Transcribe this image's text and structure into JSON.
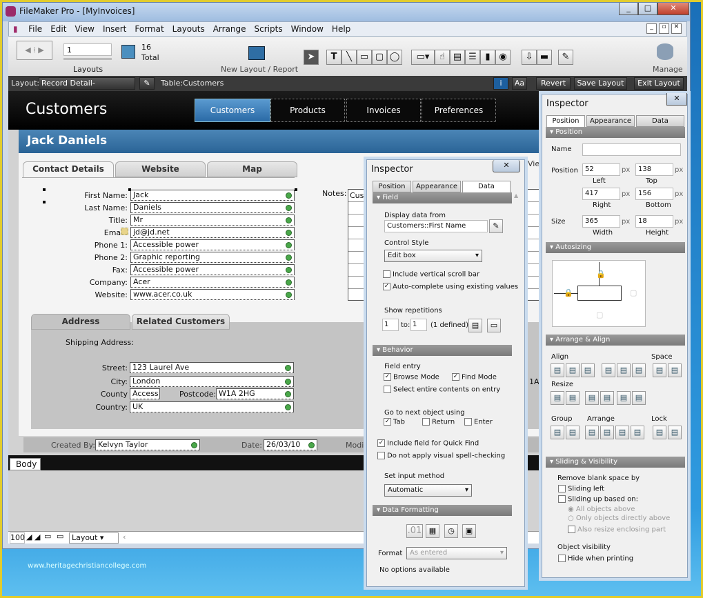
{
  "window": {
    "title": "FileMaker Pro - [MyInvoices]",
    "controls": [
      "_",
      "□",
      "✕"
    ],
    "doc_controls": [
      "_",
      "▫",
      "✕"
    ]
  },
  "menu": [
    "File",
    "Edit",
    "View",
    "Insert",
    "Format",
    "Layouts",
    "Arrange",
    "Scripts",
    "Window",
    "Help"
  ],
  "toolbar": {
    "layout_number": "1",
    "layouts_label": "Layouts",
    "total_count": "16",
    "total_label": "Total",
    "new_layout_label": "New Layout / Report",
    "manage_label": "Manage"
  },
  "layoutbar": {
    "layout_label": "Layout:",
    "layout_value": "Record Detail-Customers",
    "table_label": "Table:",
    "table_value": "Customers",
    "revert": "Revert",
    "save": "Save Layout",
    "exit": "Exit Layout"
  },
  "header": {
    "title": "Customers",
    "nav": [
      "Customers",
      "Products",
      "Invoices",
      "Preferences"
    ],
    "record_name": "Jack Daniels"
  },
  "tabs": [
    "Contact Details",
    "Website",
    "Map"
  ],
  "fields": [
    {
      "label": "First Name:",
      "value": "Jack"
    },
    {
      "label": "Last Name:",
      "value": "Daniels"
    },
    {
      "label": "Title:",
      "value": "Mr"
    },
    {
      "label": "Email:",
      "value": "jd@jd.net"
    },
    {
      "label": "Phone 1:",
      "value": "Accessible power"
    },
    {
      "label": "Phone 2:",
      "value": "Graphic reporting"
    },
    {
      "label": "Fax:",
      "value": "Accessible power"
    },
    {
      "label": "Company:",
      "value": "Acer"
    },
    {
      "label": "Website:",
      "value": "www.acer.co.uk"
    }
  ],
  "notes": {
    "label": "Notes:",
    "value": "Cust"
  },
  "address": {
    "tabs": [
      "Address",
      "Related Customers"
    ],
    "shipping_label": "Shipping Address:",
    "street": {
      "label": "Street:",
      "value": "123 Laurel Ave"
    },
    "city": {
      "label": "City:",
      "value": "London"
    },
    "county": {
      "label": "County",
      "value": "Access"
    },
    "postcode": {
      "label": "Postcode:",
      "value": "W1A 2HG"
    },
    "country": {
      "label": "Country:",
      "value": "UK"
    },
    "right_fragment": "1A"
  },
  "footer": {
    "created_label": "Created By:",
    "created_value": "Kelvyn Taylor",
    "date_label": "Date:",
    "date_value": "26/03/10",
    "modified_label": "Modifi"
  },
  "part_label": "Body",
  "statusbar": {
    "zoom": "100",
    "mode": "Layout"
  },
  "watermark": "www.heritagechristiancollege.com",
  "inspector_data": {
    "title": "Inspector",
    "tabs": [
      "Position",
      "Appearance",
      "Data"
    ],
    "active_tab": "Data",
    "behind_text": "View",
    "field_section": "Field",
    "display_from_label": "Display data from",
    "display_from_value": "Customers::First Name",
    "control_style_label": "Control Style",
    "control_style_value": "Edit box",
    "vscroll": {
      "label": "Include vertical scroll bar",
      "checked": false
    },
    "autocomplete": {
      "label": "Auto-complete using existing values",
      "checked": true
    },
    "show_rep_label": "Show repetitions",
    "rep_from": "1",
    "rep_to_label": "to:",
    "rep_to": "1",
    "rep_defined": "(1 defined)",
    "behavior_section": "Behavior",
    "field_entry_label": "Field entry",
    "browse_mode": {
      "label": "Browse Mode",
      "checked": true
    },
    "find_mode": {
      "label": "Find Mode",
      "checked": true
    },
    "select_entire": {
      "label": "Select entire contents on entry",
      "checked": false
    },
    "next_object_label": "Go to next object using",
    "tab": {
      "label": "Tab",
      "checked": true
    },
    "return": {
      "label": "Return",
      "checked": false
    },
    "enter": {
      "label": "Enter",
      "checked": false
    },
    "quick_find": {
      "label": "Include field for Quick Find",
      "checked": true
    },
    "spell": {
      "label": "Do not apply visual spell-checking",
      "checked": false
    },
    "input_method_label": "Set input method",
    "input_method_value": "Automatic",
    "formatting_section": "Data Formatting",
    "format_icons": [
      ".01",
      "calendar",
      "clock",
      "image"
    ],
    "format_label": "Format",
    "format_value": "As entered",
    "no_options": "No options available"
  },
  "inspector_position": {
    "title": "Inspector",
    "tabs": [
      "Position",
      "Appearance",
      "Data"
    ],
    "active_tab": "Position",
    "position_section": "Position",
    "name_label": "Name",
    "name_value": "",
    "position_label": "Position",
    "left": "52",
    "top": "138",
    "right": "417",
    "bottom": "156",
    "left_label": "Left",
    "top_label": "Top",
    "right_label": "Right",
    "bottom_label": "Bottom",
    "size_label": "Size",
    "width": "365",
    "height": "18",
    "width_label": "Width",
    "height_label": "Height",
    "unit": "px",
    "autosizing_section": "Autosizing",
    "arrange_section": "Arrange & Align",
    "align_label": "Align",
    "space_label": "Space",
    "resize_label": "Resize",
    "group_label": "Group",
    "arrange_label": "Arrange",
    "lock_label": "Lock",
    "sliding_section": "Sliding & Visibility",
    "remove_blank_label": "Remove blank space by",
    "sliding_left": "Sliding left",
    "sliding_up": "Sliding up based on:",
    "all_above": "All objects above",
    "directly_above": "Only objects directly above",
    "resize_enclosing": "Also resize enclosing part",
    "visibility_label": "Object visibility",
    "hide_printing": "Hide when printing"
  }
}
